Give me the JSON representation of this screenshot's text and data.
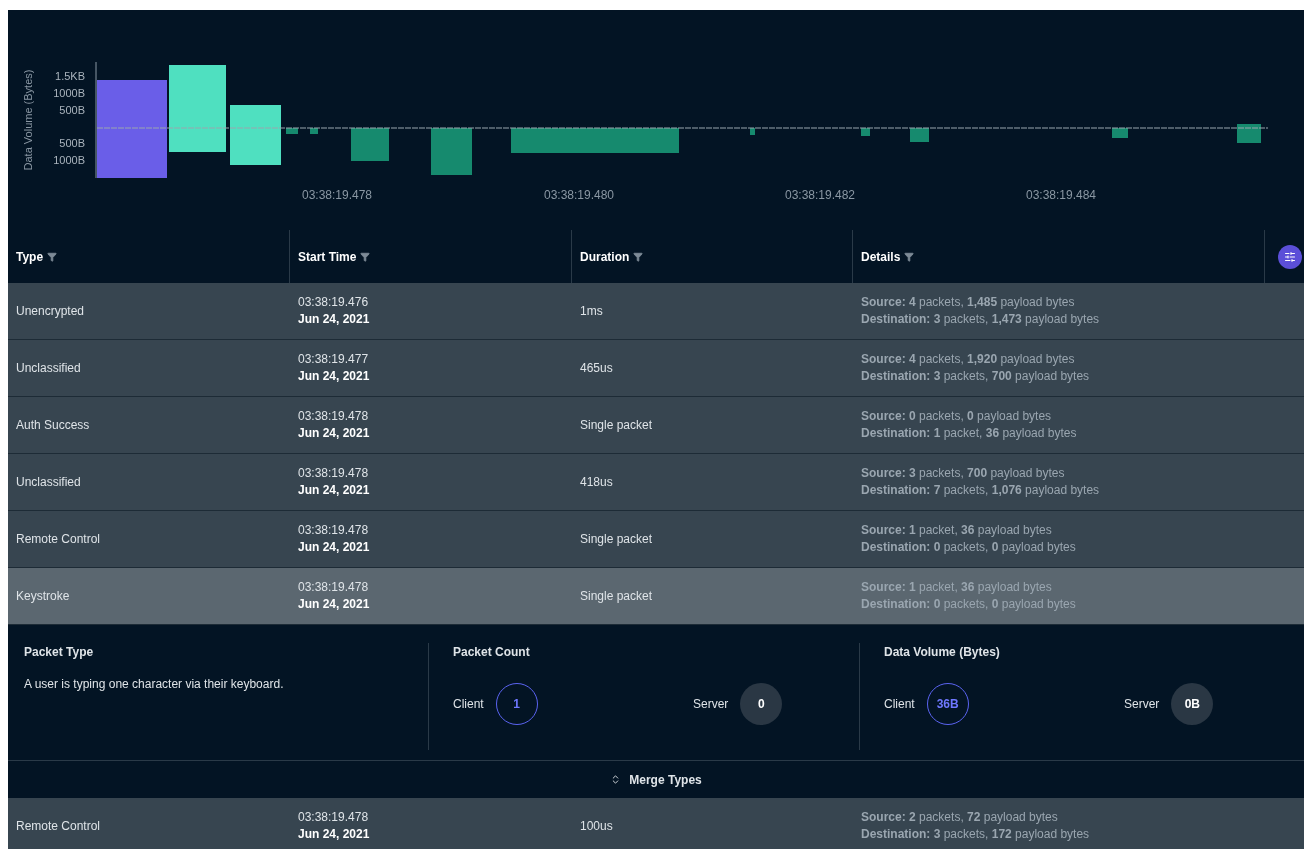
{
  "chart": {
    "axis_title": "Data Volume (Bytes)",
    "y_tick_labels": [
      "1.5KB",
      "1000B",
      "500B",
      "500B",
      "1000B"
    ],
    "x_tick_labels": [
      "03:38:19.478",
      "03:38:19.480",
      "03:38:19.482",
      "03:38:19.484"
    ]
  },
  "table": {
    "columns": [
      "Type",
      "Start Time",
      "Duration",
      "Details"
    ],
    "rows": [
      {
        "type": "Unencrypted",
        "time": "03:38:19.476",
        "date": "Jun 24, 2021",
        "duration": "1ms",
        "source": "**Source: 4** packets, **1,485** payload bytes",
        "destination": "**Destination: 3** packets, **1,473** payload bytes",
        "selected": false
      },
      {
        "type": "Unclassified",
        "time": "03:38:19.477",
        "date": "Jun 24, 2021",
        "duration": "465us",
        "source": "**Source: 4** packets, **1,920** payload bytes",
        "destination": "**Destination: 3** packets, **700** payload bytes",
        "selected": false
      },
      {
        "type": "Auth Success",
        "time": "03:38:19.478",
        "date": "Jun 24, 2021",
        "duration": "Single packet",
        "source": "**Source: 0** packets, **0** payload bytes",
        "destination": "**Destination: 1** packet, **36** payload bytes",
        "selected": false
      },
      {
        "type": "Unclassified",
        "time": "03:38:19.478",
        "date": "Jun 24, 2021",
        "duration": "418us",
        "source": "**Source: 3** packets, **700** payload bytes",
        "destination": "**Destination: 7** packets, **1,076** payload bytes",
        "selected": false
      },
      {
        "type": "Remote Control",
        "time": "03:38:19.478",
        "date": "Jun 24, 2021",
        "duration": "Single packet",
        "source": "**Source: 1** packet, **36** payload bytes",
        "destination": "**Destination: 0** packets, **0** payload bytes",
        "selected": false
      },
      {
        "type": "Keystroke",
        "time": "03:38:19.478",
        "date": "Jun 24, 2021",
        "duration": "Single packet",
        "source": "**Source: 1** packet, **36** payload bytes",
        "destination": "**Destination: 0** packets, **0** payload bytes",
        "selected": true
      }
    ],
    "detail": {
      "packet_type": {
        "title": "Packet Type",
        "description": "A user is typing one character via their keyboard."
      },
      "sections": [
        {
          "title": "Packet Count",
          "items": [
            {
              "label": "Client",
              "value": "1",
              "kind": "outline"
            },
            {
              "label": "Server",
              "value": "0",
              "kind": "filled"
            }
          ]
        },
        {
          "title": "Data Volume (Bytes)",
          "items": [
            {
              "label": "Client",
              "value": "36B",
              "kind": "outline"
            },
            {
              "label": "Server",
              "value": "0B",
              "kind": "filled"
            }
          ]
        }
      ]
    },
    "merge_button": "Merge Types",
    "after_rows": [
      {
        "type": "Remote Control",
        "time": "03:38:19.478",
        "date": "Jun 24, 2021",
        "duration": "100us",
        "source": "**Source: 2** packets, **72** payload bytes",
        "destination": "**Destination: 3** packets, **172** payload bytes",
        "selected": false
      }
    ]
  }
}
